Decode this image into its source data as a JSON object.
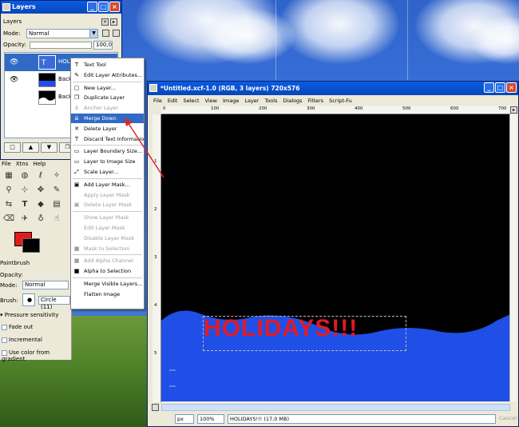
{
  "layers_dock": {
    "title": "Layers",
    "tab_label": "Layers",
    "mode_label": "Mode:",
    "mode_value": "Normal",
    "opacity_label": "Opacity:",
    "opacity_value": "100,0",
    "layers": [
      {
        "name": "HOLIDAYS",
        "selected": true
      },
      {
        "name": "Backg",
        "selected": false
      },
      {
        "name": "Backg",
        "selected": false
      }
    ]
  },
  "toolbox": {
    "menu": [
      "File",
      "Xtns",
      "Help"
    ],
    "tool_options_title": "Paintbrush",
    "opacity_label": "Opacity:",
    "mode_label": "Mode:",
    "mode_value": "Normal",
    "brush_label": "Brush:",
    "brush_value": "Circle (11)",
    "pressure_label": "Pressure sensitivity",
    "fade_out_label": "Fade out",
    "incremental_label": "Incremental",
    "gradient_label": "Use color from gradient",
    "fg_color": "#e51b1b",
    "bg_color": "#000000"
  },
  "context_menu": {
    "items": [
      {
        "label": "Text Tool",
        "icon": "T",
        "disabled": false
      },
      {
        "label": "Edit Layer Attributes...",
        "icon": "✎",
        "disabled": false
      },
      {
        "sep": true
      },
      {
        "label": "New Layer...",
        "icon": "▢",
        "disabled": false
      },
      {
        "label": "Duplicate Layer",
        "icon": "❐",
        "disabled": false
      },
      {
        "label": "Anchor Layer",
        "icon": "⚓",
        "disabled": true
      },
      {
        "label": "Merge Down",
        "icon": "⇊",
        "disabled": false,
        "highlighted": true
      },
      {
        "label": "Delete Layer",
        "icon": "✕",
        "disabled": false
      },
      {
        "label": "Discard Text Information",
        "icon": "T",
        "disabled": false
      },
      {
        "sep": true
      },
      {
        "label": "Layer Boundary Size...",
        "icon": "▭",
        "disabled": false
      },
      {
        "label": "Layer to Image Size",
        "icon": "▭",
        "disabled": false
      },
      {
        "label": "Scale Layer...",
        "icon": "⤢",
        "disabled": false
      },
      {
        "sep": true
      },
      {
        "label": "Add Layer Mask...",
        "icon": "▣",
        "disabled": false
      },
      {
        "label": "Apply Layer Mask",
        "icon": "",
        "disabled": true
      },
      {
        "label": "Delete Layer Mask",
        "icon": "▣",
        "disabled": true
      },
      {
        "sep": true
      },
      {
        "label": "Show Layer Mask",
        "icon": "",
        "disabled": true
      },
      {
        "label": "Edit Layer Mask",
        "icon": "",
        "disabled": true
      },
      {
        "label": "Disable Layer Mask",
        "icon": "",
        "disabled": true
      },
      {
        "label": "Mask to Selection",
        "icon": "■",
        "disabled": true
      },
      {
        "sep": true
      },
      {
        "label": "Add Alpha Channel",
        "icon": "■",
        "disabled": true
      },
      {
        "label": "Alpha to Selection",
        "icon": "■",
        "disabled": false
      },
      {
        "sep": true
      },
      {
        "label": "Merge Visible Layers...",
        "icon": "",
        "disabled": false
      },
      {
        "label": "Flatten Image",
        "icon": "",
        "disabled": false
      }
    ]
  },
  "image_window": {
    "title": "*Untitled.xcf-1.0 (RGB, 3 layers) 720x576",
    "menu": [
      "File",
      "Edit",
      "Select",
      "View",
      "Image",
      "Layer",
      "Tools",
      "Dialogs",
      "Filters",
      "Script-Fu"
    ],
    "ruler_h": [
      "0",
      "100",
      "200",
      "300",
      "400",
      "500",
      "600",
      "700"
    ],
    "ruler_v": [
      "1",
      "2",
      "3",
      "4",
      "5"
    ],
    "canvas_text": "HOLIDAYS!!!",
    "canvas_text_color": "#e01b24",
    "water_color": "#1f4fe6",
    "status_unit": "px",
    "status_zoom": "100%",
    "status_message": "HOLIDAYS!!! (17,0 MB)",
    "cancel_label": "Cancel"
  }
}
